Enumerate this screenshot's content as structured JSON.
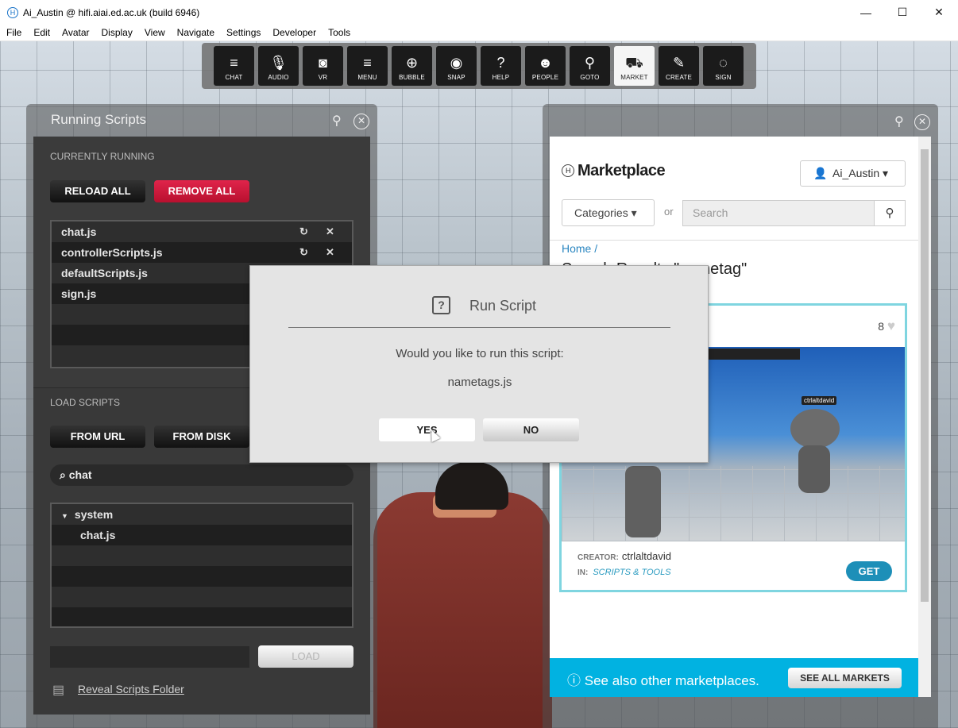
{
  "window": {
    "title": "Ai_Austin @ hifi.aiai.ed.ac.uk (build 6946)",
    "app_icon": "H",
    "minimize": "—",
    "maximize": "☐",
    "close": "✕"
  },
  "menu": [
    "File",
    "Edit",
    "Avatar",
    "Display",
    "View",
    "Navigate",
    "Settings",
    "Developer",
    "Tools"
  ],
  "toolbar": [
    {
      "label": "CHAT",
      "icon": "≡"
    },
    {
      "label": "AUDIO",
      "icon": "🎙"
    },
    {
      "label": "VR",
      "icon": "◙"
    },
    {
      "label": "MENU",
      "icon": "≡"
    },
    {
      "label": "BUBBLE",
      "icon": "⊕"
    },
    {
      "label": "SNAP",
      "icon": "◉"
    },
    {
      "label": "HELP",
      "icon": "?"
    },
    {
      "label": "PEOPLE",
      "icon": "☻"
    },
    {
      "label": "GOTO",
      "icon": "⚲"
    },
    {
      "label": "MARKET",
      "icon": "⛟"
    },
    {
      "label": "CREATE",
      "icon": "✎"
    },
    {
      "label": "SIGN",
      "icon": "◌"
    }
  ],
  "running_scripts": {
    "title": "Running Scripts",
    "currently_running_label": "CURRENTLY RUNNING",
    "reload_all": "RELOAD ALL",
    "remove_all": "REMOVE ALL",
    "scripts": [
      "chat.js",
      "controllerScripts.js",
      "defaultScripts.js",
      "sign.js"
    ],
    "load_scripts_label": "LOAD SCRIPTS",
    "from_url": "FROM URL",
    "from_disk": "FROM DISK",
    "filter": "chat",
    "tree_folder": "system",
    "tree_file": "chat.js",
    "load_button": "LOAD",
    "reveal_folder": "Reveal Scripts Folder"
  },
  "marketplace": {
    "title": "Marketplace",
    "user": "Ai_Austin",
    "categories": "Categories",
    "or": "or",
    "search_placeholder": "Search",
    "breadcrumb": "Home /",
    "results_title": "Search Results \"nametag\"",
    "likes": "8",
    "robot_tag": "ctrlaltdavid",
    "creator_label": "CREATOR:",
    "creator": "ctrlaltdavid",
    "in_label": "IN:",
    "category": "SCRIPTS & TOOLS",
    "get": "GET",
    "banner_text": "See also other marketplaces.",
    "banner_button": "SEE ALL MARKETS"
  },
  "dialog": {
    "title": "Run Script",
    "question": "Would you like to run this script:",
    "filename": "nametags.js",
    "yes": "YES",
    "no": "NO"
  }
}
